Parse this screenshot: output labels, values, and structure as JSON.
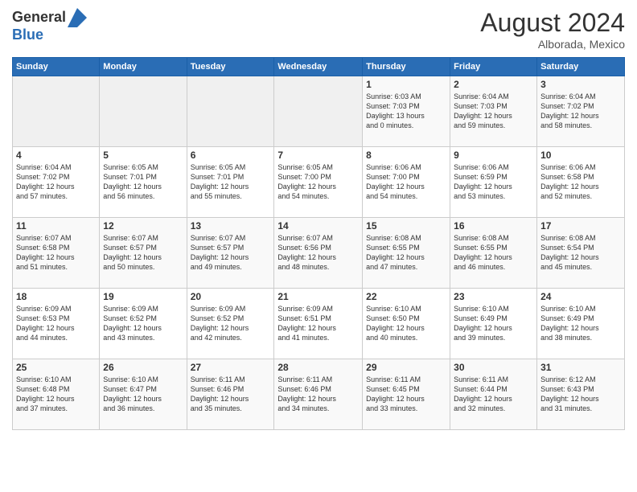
{
  "header": {
    "logo_line1": "General",
    "logo_line2": "Blue",
    "month_year": "August 2024",
    "location": "Alborada, Mexico"
  },
  "calendar": {
    "days_of_week": [
      "Sunday",
      "Monday",
      "Tuesday",
      "Wednesday",
      "Thursday",
      "Friday",
      "Saturday"
    ],
    "weeks": [
      [
        {
          "day": "",
          "info": ""
        },
        {
          "day": "",
          "info": ""
        },
        {
          "day": "",
          "info": ""
        },
        {
          "day": "",
          "info": ""
        },
        {
          "day": "1",
          "info": "Sunrise: 6:03 AM\nSunset: 7:03 PM\nDaylight: 13 hours\nand 0 minutes."
        },
        {
          "day": "2",
          "info": "Sunrise: 6:04 AM\nSunset: 7:03 PM\nDaylight: 12 hours\nand 59 minutes."
        },
        {
          "day": "3",
          "info": "Sunrise: 6:04 AM\nSunset: 7:02 PM\nDaylight: 12 hours\nand 58 minutes."
        }
      ],
      [
        {
          "day": "4",
          "info": "Sunrise: 6:04 AM\nSunset: 7:02 PM\nDaylight: 12 hours\nand 57 minutes."
        },
        {
          "day": "5",
          "info": "Sunrise: 6:05 AM\nSunset: 7:01 PM\nDaylight: 12 hours\nand 56 minutes."
        },
        {
          "day": "6",
          "info": "Sunrise: 6:05 AM\nSunset: 7:01 PM\nDaylight: 12 hours\nand 55 minutes."
        },
        {
          "day": "7",
          "info": "Sunrise: 6:05 AM\nSunset: 7:00 PM\nDaylight: 12 hours\nand 54 minutes."
        },
        {
          "day": "8",
          "info": "Sunrise: 6:06 AM\nSunset: 7:00 PM\nDaylight: 12 hours\nand 54 minutes."
        },
        {
          "day": "9",
          "info": "Sunrise: 6:06 AM\nSunset: 6:59 PM\nDaylight: 12 hours\nand 53 minutes."
        },
        {
          "day": "10",
          "info": "Sunrise: 6:06 AM\nSunset: 6:58 PM\nDaylight: 12 hours\nand 52 minutes."
        }
      ],
      [
        {
          "day": "11",
          "info": "Sunrise: 6:07 AM\nSunset: 6:58 PM\nDaylight: 12 hours\nand 51 minutes."
        },
        {
          "day": "12",
          "info": "Sunrise: 6:07 AM\nSunset: 6:57 PM\nDaylight: 12 hours\nand 50 minutes."
        },
        {
          "day": "13",
          "info": "Sunrise: 6:07 AM\nSunset: 6:57 PM\nDaylight: 12 hours\nand 49 minutes."
        },
        {
          "day": "14",
          "info": "Sunrise: 6:07 AM\nSunset: 6:56 PM\nDaylight: 12 hours\nand 48 minutes."
        },
        {
          "day": "15",
          "info": "Sunrise: 6:08 AM\nSunset: 6:55 PM\nDaylight: 12 hours\nand 47 minutes."
        },
        {
          "day": "16",
          "info": "Sunrise: 6:08 AM\nSunset: 6:55 PM\nDaylight: 12 hours\nand 46 minutes."
        },
        {
          "day": "17",
          "info": "Sunrise: 6:08 AM\nSunset: 6:54 PM\nDaylight: 12 hours\nand 45 minutes."
        }
      ],
      [
        {
          "day": "18",
          "info": "Sunrise: 6:09 AM\nSunset: 6:53 PM\nDaylight: 12 hours\nand 44 minutes."
        },
        {
          "day": "19",
          "info": "Sunrise: 6:09 AM\nSunset: 6:52 PM\nDaylight: 12 hours\nand 43 minutes."
        },
        {
          "day": "20",
          "info": "Sunrise: 6:09 AM\nSunset: 6:52 PM\nDaylight: 12 hours\nand 42 minutes."
        },
        {
          "day": "21",
          "info": "Sunrise: 6:09 AM\nSunset: 6:51 PM\nDaylight: 12 hours\nand 41 minutes."
        },
        {
          "day": "22",
          "info": "Sunrise: 6:10 AM\nSunset: 6:50 PM\nDaylight: 12 hours\nand 40 minutes."
        },
        {
          "day": "23",
          "info": "Sunrise: 6:10 AM\nSunset: 6:49 PM\nDaylight: 12 hours\nand 39 minutes."
        },
        {
          "day": "24",
          "info": "Sunrise: 6:10 AM\nSunset: 6:49 PM\nDaylight: 12 hours\nand 38 minutes."
        }
      ],
      [
        {
          "day": "25",
          "info": "Sunrise: 6:10 AM\nSunset: 6:48 PM\nDaylight: 12 hours\nand 37 minutes."
        },
        {
          "day": "26",
          "info": "Sunrise: 6:10 AM\nSunset: 6:47 PM\nDaylight: 12 hours\nand 36 minutes."
        },
        {
          "day": "27",
          "info": "Sunrise: 6:11 AM\nSunset: 6:46 PM\nDaylight: 12 hours\nand 35 minutes."
        },
        {
          "day": "28",
          "info": "Sunrise: 6:11 AM\nSunset: 6:46 PM\nDaylight: 12 hours\nand 34 minutes."
        },
        {
          "day": "29",
          "info": "Sunrise: 6:11 AM\nSunset: 6:45 PM\nDaylight: 12 hours\nand 33 minutes."
        },
        {
          "day": "30",
          "info": "Sunrise: 6:11 AM\nSunset: 6:44 PM\nDaylight: 12 hours\nand 32 minutes."
        },
        {
          "day": "31",
          "info": "Sunrise: 6:12 AM\nSunset: 6:43 PM\nDaylight: 12 hours\nand 31 minutes."
        }
      ]
    ]
  }
}
